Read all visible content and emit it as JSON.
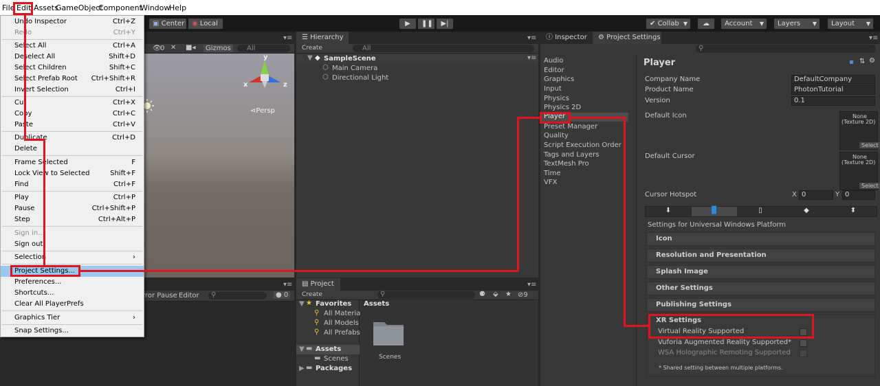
{
  "menubar": {
    "items": [
      "File",
      "Edit",
      "Assets",
      "GameObject",
      "Component",
      "Window",
      "Help"
    ]
  },
  "toolbar": {
    "center": "Center",
    "local": "Local",
    "collab": "Collab",
    "account": "Account",
    "layers": "Layers",
    "layout": "Layout"
  },
  "scene": {
    "gizmos": "Gizmos",
    "search": "All",
    "persp": "Persp",
    "layer_count": "0",
    "axes": {
      "x": "x",
      "y": "y",
      "z": "z"
    }
  },
  "console": {
    "error_pause": "rror Pause",
    "editor": "Editor",
    "count": "0"
  },
  "hierarchy": {
    "tab": "Hierarchy",
    "create": "Create",
    "search": "All",
    "scene": "SampleScene",
    "items": [
      "Main Camera",
      "Directional Light"
    ]
  },
  "project": {
    "tab": "Project",
    "create": "Create",
    "favorites": "Favorites",
    "favorite_items": [
      "All Material",
      "All Models",
      "All Prefabs"
    ],
    "assets": "Assets",
    "scenes": "Scenes",
    "packages": "Packages",
    "breadcrumb": "Assets",
    "folder": "Scenes",
    "hidden_count": "9"
  },
  "inspector": {
    "tab_inspector": "Inspector",
    "tab_project_settings": "Project Settings"
  },
  "settings_nav": [
    "Audio",
    "Editor",
    "Graphics",
    "Input",
    "Physics",
    "Physics 2D",
    "Player",
    "Preset Manager",
    "Quality",
    "Script Execution Order",
    "Tags and Layers",
    "TextMesh Pro",
    "Time",
    "VFX"
  ],
  "player": {
    "title": "Player",
    "company_label": "Company Name",
    "company_value": "DefaultCompany",
    "product_label": "Product Name",
    "product_value": "PhotonTutorial",
    "version_label": "Version",
    "version_value": "0.1",
    "default_icon_label": "Default Icon",
    "default_cursor_label": "Default Cursor",
    "none_texture_1": "None",
    "none_texture_2": "(Texture 2D)",
    "select": "Select",
    "cursor_hotspot_label": "Cursor Hotspot",
    "hotspot_x_label": "X",
    "hotspot_x": "0",
    "hotspot_y_label": "Y",
    "hotspot_y": "0",
    "platform_heading": "Settings for Universal Windows Platform",
    "sections": [
      "Icon",
      "Resolution and Presentation",
      "Splash Image",
      "Other Settings",
      "Publishing Settings"
    ],
    "xr_heading": "XR Settings",
    "xr_items": [
      "Virtual Reality Supported",
      "Vuforia Augmented Reality Supported*",
      "WSA Holographic Remoting Supported"
    ],
    "footnote": "* Shared setting between multiple platforms."
  },
  "edit_menu": [
    {
      "label": "Undo Inspector",
      "shortcut": "Ctrl+Z"
    },
    {
      "label": "Redo",
      "shortcut": "Ctrl+Y",
      "disabled": true
    },
    {
      "label": "Select All",
      "shortcut": "Ctrl+A"
    },
    {
      "label": "Deselect All",
      "shortcut": "Shift+D"
    },
    {
      "label": "Select Children",
      "shortcut": "Shift+C"
    },
    {
      "label": "Select Prefab Root",
      "shortcut": "Ctrl+Shift+R"
    },
    {
      "label": "Invert Selection",
      "shortcut": "Ctrl+I"
    },
    {
      "label": "Cut",
      "shortcut": "Ctrl+X"
    },
    {
      "label": "Copy",
      "shortcut": "Ctrl+C"
    },
    {
      "label": "Paste",
      "shortcut": "Ctrl+V"
    },
    {
      "label": "Duplicate",
      "shortcut": "Ctrl+D"
    },
    {
      "label": "Delete",
      "shortcut": ""
    },
    {
      "label": "Frame Selected",
      "shortcut": "F"
    },
    {
      "label": "Lock View to Selected",
      "shortcut": "Shift+F"
    },
    {
      "label": "Find",
      "shortcut": "Ctrl+F"
    },
    {
      "label": "Play",
      "shortcut": "Ctrl+P"
    },
    {
      "label": "Pause",
      "shortcut": "Ctrl+Shift+P"
    },
    {
      "label": "Step",
      "shortcut": "Ctrl+Alt+P"
    },
    {
      "label": "Sign in...",
      "shortcut": "",
      "disabled": true
    },
    {
      "label": "Sign out",
      "shortcut": ""
    },
    {
      "label": "Selection",
      "shortcut": "›"
    },
    {
      "label": "Project Settings...",
      "shortcut": ""
    },
    {
      "label": "Preferences...",
      "shortcut": ""
    },
    {
      "label": "Shortcuts...",
      "shortcut": ""
    },
    {
      "label": "Clear All PlayerPrefs",
      "shortcut": ""
    },
    {
      "label": "Graphics Tier",
      "shortcut": "›"
    },
    {
      "label": "Snap Settings...",
      "shortcut": ""
    }
  ],
  "colors": {
    "highlight": "#e0141e",
    "menu_selection": "#99c9ef",
    "panel": "#383838"
  }
}
